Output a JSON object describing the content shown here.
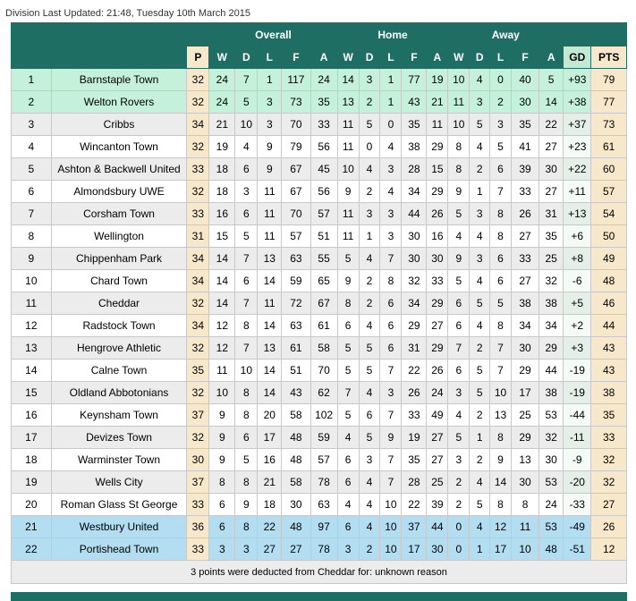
{
  "updated": "Division Last Updated: 21:48, Tuesday 10th March 2015",
  "groups": {
    "overall": "Overall",
    "home": "Home",
    "away": "Away"
  },
  "columns": [
    "P",
    "W",
    "D",
    "L",
    "F",
    "A",
    "W",
    "D",
    "L",
    "F",
    "A",
    "W",
    "D",
    "L",
    "F",
    "A",
    "GD",
    "PTS"
  ],
  "rows": [
    {
      "pos": "1",
      "team": "Barnstaple Town",
      "cells": [
        "32",
        "24",
        "7",
        "1",
        "117",
        "24",
        "14",
        "3",
        "1",
        "77",
        "19",
        "10",
        "4",
        "0",
        "40",
        "5",
        "+93",
        "79"
      ],
      "style": "promo"
    },
    {
      "pos": "2",
      "team": "Welton Rovers",
      "cells": [
        "32",
        "24",
        "5",
        "3",
        "73",
        "35",
        "13",
        "2",
        "1",
        "43",
        "21",
        "11",
        "3",
        "2",
        "30",
        "14",
        "+38",
        "77"
      ],
      "style": "promo"
    },
    {
      "pos": "3",
      "team": "Cribbs",
      "cells": [
        "34",
        "21",
        "10",
        "3",
        "70",
        "33",
        "11",
        "5",
        "0",
        "35",
        "11",
        "10",
        "5",
        "3",
        "35",
        "22",
        "+37",
        "73"
      ],
      "style": "alt"
    },
    {
      "pos": "4",
      "team": "Wincanton Town",
      "cells": [
        "32",
        "19",
        "4",
        "9",
        "79",
        "56",
        "11",
        "0",
        "4",
        "38",
        "29",
        "8",
        "4",
        "5",
        "41",
        "27",
        "+23",
        "61"
      ],
      "style": ""
    },
    {
      "pos": "5",
      "team": "Ashton & Backwell United",
      "cells": [
        "33",
        "18",
        "6",
        "9",
        "67",
        "45",
        "10",
        "4",
        "3",
        "28",
        "15",
        "8",
        "2",
        "6",
        "39",
        "30",
        "+22",
        "60"
      ],
      "style": "alt"
    },
    {
      "pos": "6",
      "team": "Almondsbury UWE",
      "cells": [
        "32",
        "18",
        "3",
        "11",
        "67",
        "56",
        "9",
        "2",
        "4",
        "34",
        "29",
        "9",
        "1",
        "7",
        "33",
        "27",
        "+11",
        "57"
      ],
      "style": ""
    },
    {
      "pos": "7",
      "team": "Corsham Town",
      "cells": [
        "33",
        "16",
        "6",
        "11",
        "70",
        "57",
        "11",
        "3",
        "3",
        "44",
        "26",
        "5",
        "3",
        "8",
        "26",
        "31",
        "+13",
        "54"
      ],
      "style": "alt"
    },
    {
      "pos": "8",
      "team": "Wellington",
      "cells": [
        "31",
        "15",
        "5",
        "11",
        "57",
        "51",
        "11",
        "1",
        "3",
        "30",
        "16",
        "4",
        "4",
        "8",
        "27",
        "35",
        "+6",
        "50"
      ],
      "style": ""
    },
    {
      "pos": "9",
      "team": "Chippenham Park",
      "cells": [
        "34",
        "14",
        "7",
        "13",
        "63",
        "55",
        "5",
        "4",
        "7",
        "30",
        "30",
        "9",
        "3",
        "6",
        "33",
        "25",
        "+8",
        "49"
      ],
      "style": "alt"
    },
    {
      "pos": "10",
      "team": "Chard Town",
      "cells": [
        "34",
        "14",
        "6",
        "14",
        "59",
        "65",
        "9",
        "2",
        "8",
        "32",
        "33",
        "5",
        "4",
        "6",
        "27",
        "32",
        "-6",
        "48"
      ],
      "style": ""
    },
    {
      "pos": "11",
      "team": "Cheddar",
      "cells": [
        "32",
        "14",
        "7",
        "11",
        "72",
        "67",
        "8",
        "2",
        "6",
        "34",
        "29",
        "6",
        "5",
        "5",
        "38",
        "38",
        "+5",
        "46"
      ],
      "style": "alt"
    },
    {
      "pos": "12",
      "team": "Radstock Town",
      "cells": [
        "34",
        "12",
        "8",
        "14",
        "63",
        "61",
        "6",
        "4",
        "6",
        "29",
        "27",
        "6",
        "4",
        "8",
        "34",
        "34",
        "+2",
        "44"
      ],
      "style": ""
    },
    {
      "pos": "13",
      "team": "Hengrove Athletic",
      "cells": [
        "32",
        "12",
        "7",
        "13",
        "61",
        "58",
        "5",
        "5",
        "6",
        "31",
        "29",
        "7",
        "2",
        "7",
        "30",
        "29",
        "+3",
        "43"
      ],
      "style": "alt"
    },
    {
      "pos": "14",
      "team": "Calne Town",
      "cells": [
        "35",
        "11",
        "10",
        "14",
        "51",
        "70",
        "5",
        "5",
        "7",
        "22",
        "26",
        "6",
        "5",
        "7",
        "29",
        "44",
        "-19",
        "43"
      ],
      "style": ""
    },
    {
      "pos": "15",
      "team": "Oldland Abbotonians",
      "cells": [
        "32",
        "10",
        "8",
        "14",
        "43",
        "62",
        "7",
        "4",
        "3",
        "26",
        "24",
        "3",
        "5",
        "10",
        "17",
        "38",
        "-19",
        "38"
      ],
      "style": "alt"
    },
    {
      "pos": "16",
      "team": "Keynsham Town",
      "cells": [
        "37",
        "9",
        "8",
        "20",
        "58",
        "102",
        "5",
        "6",
        "7",
        "33",
        "49",
        "4",
        "2",
        "13",
        "25",
        "53",
        "-44",
        "35"
      ],
      "style": ""
    },
    {
      "pos": "17",
      "team": "Devizes Town",
      "cells": [
        "32",
        "9",
        "6",
        "17",
        "48",
        "59",
        "4",
        "5",
        "9",
        "19",
        "27",
        "5",
        "1",
        "8",
        "29",
        "32",
        "-11",
        "33"
      ],
      "style": "alt"
    },
    {
      "pos": "18",
      "team": "Warminster Town",
      "cells": [
        "30",
        "9",
        "5",
        "16",
        "48",
        "57",
        "6",
        "3",
        "7",
        "35",
        "27",
        "3",
        "2",
        "9",
        "13",
        "30",
        "-9",
        "32"
      ],
      "style": ""
    },
    {
      "pos": "19",
      "team": "Wells City",
      "cells": [
        "37",
        "8",
        "8",
        "21",
        "58",
        "78",
        "6",
        "4",
        "7",
        "28",
        "25",
        "2",
        "4",
        "14",
        "30",
        "53",
        "-20",
        "32"
      ],
      "style": "alt"
    },
    {
      "pos": "20",
      "team": "Roman Glass St George",
      "cells": [
        "33",
        "6",
        "9",
        "18",
        "30",
        "63",
        "4",
        "4",
        "10",
        "22",
        "39",
        "2",
        "5",
        "8",
        "8",
        "24",
        "-33",
        "27"
      ],
      "style": ""
    },
    {
      "pos": "21",
      "team": "Westbury United",
      "cells": [
        "36",
        "6",
        "8",
        "22",
        "48",
        "97",
        "6",
        "4",
        "10",
        "37",
        "44",
        "0",
        "4",
        "12",
        "11",
        "53",
        "-49",
        "26"
      ],
      "style": "releg"
    },
    {
      "pos": "22",
      "team": "Portishead Town",
      "cells": [
        "33",
        "3",
        "3",
        "27",
        "27",
        "78",
        "3",
        "2",
        "10",
        "17",
        "30",
        "0",
        "1",
        "17",
        "10",
        "48",
        "-51",
        "12"
      ],
      "style": "releg"
    }
  ],
  "note": "3 points were deducted from Cheddar for: unknown reason"
}
